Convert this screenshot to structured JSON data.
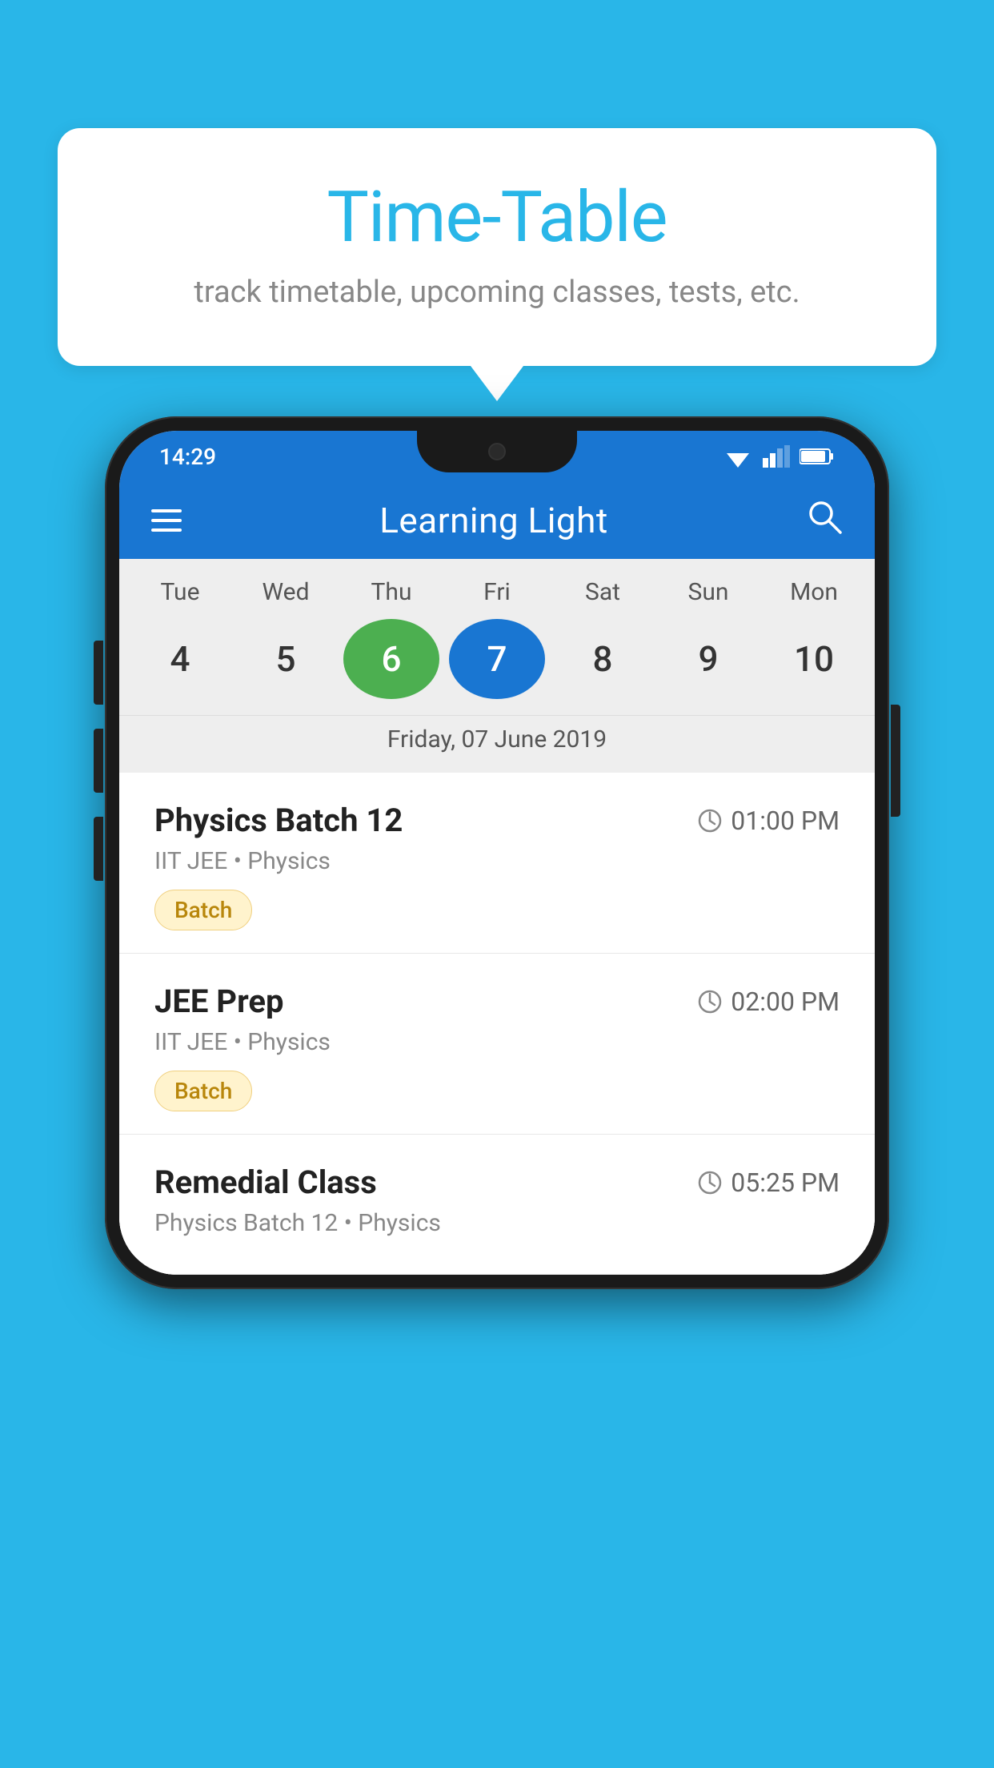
{
  "background": {
    "color": "#29b6e8"
  },
  "tooltip": {
    "title": "Time-Table",
    "subtitle": "track timetable, upcoming classes, tests, etc."
  },
  "phone": {
    "status_bar": {
      "time": "14:29"
    },
    "app_bar": {
      "title": "Learning Light",
      "menu_icon_label": "menu",
      "search_icon_label": "search"
    },
    "calendar": {
      "days": [
        {
          "label": "Tue",
          "number": "4"
        },
        {
          "label": "Wed",
          "number": "5"
        },
        {
          "label": "Thu",
          "number": "6",
          "state": "today"
        },
        {
          "label": "Fri",
          "number": "7",
          "state": "selected"
        },
        {
          "label": "Sat",
          "number": "8"
        },
        {
          "label": "Sun",
          "number": "9"
        },
        {
          "label": "Mon",
          "number": "10"
        }
      ],
      "selected_date_label": "Friday, 07 June 2019"
    },
    "schedule": [
      {
        "title": "Physics Batch 12",
        "time": "01:00 PM",
        "subtitle": "IIT JEE • Physics",
        "badge": "Batch"
      },
      {
        "title": "JEE Prep",
        "time": "02:00 PM",
        "subtitle": "IIT JEE • Physics",
        "badge": "Batch"
      },
      {
        "title": "Remedial Class",
        "time": "05:25 PM",
        "subtitle": "Physics Batch 12 • Physics",
        "badge": null
      }
    ]
  }
}
